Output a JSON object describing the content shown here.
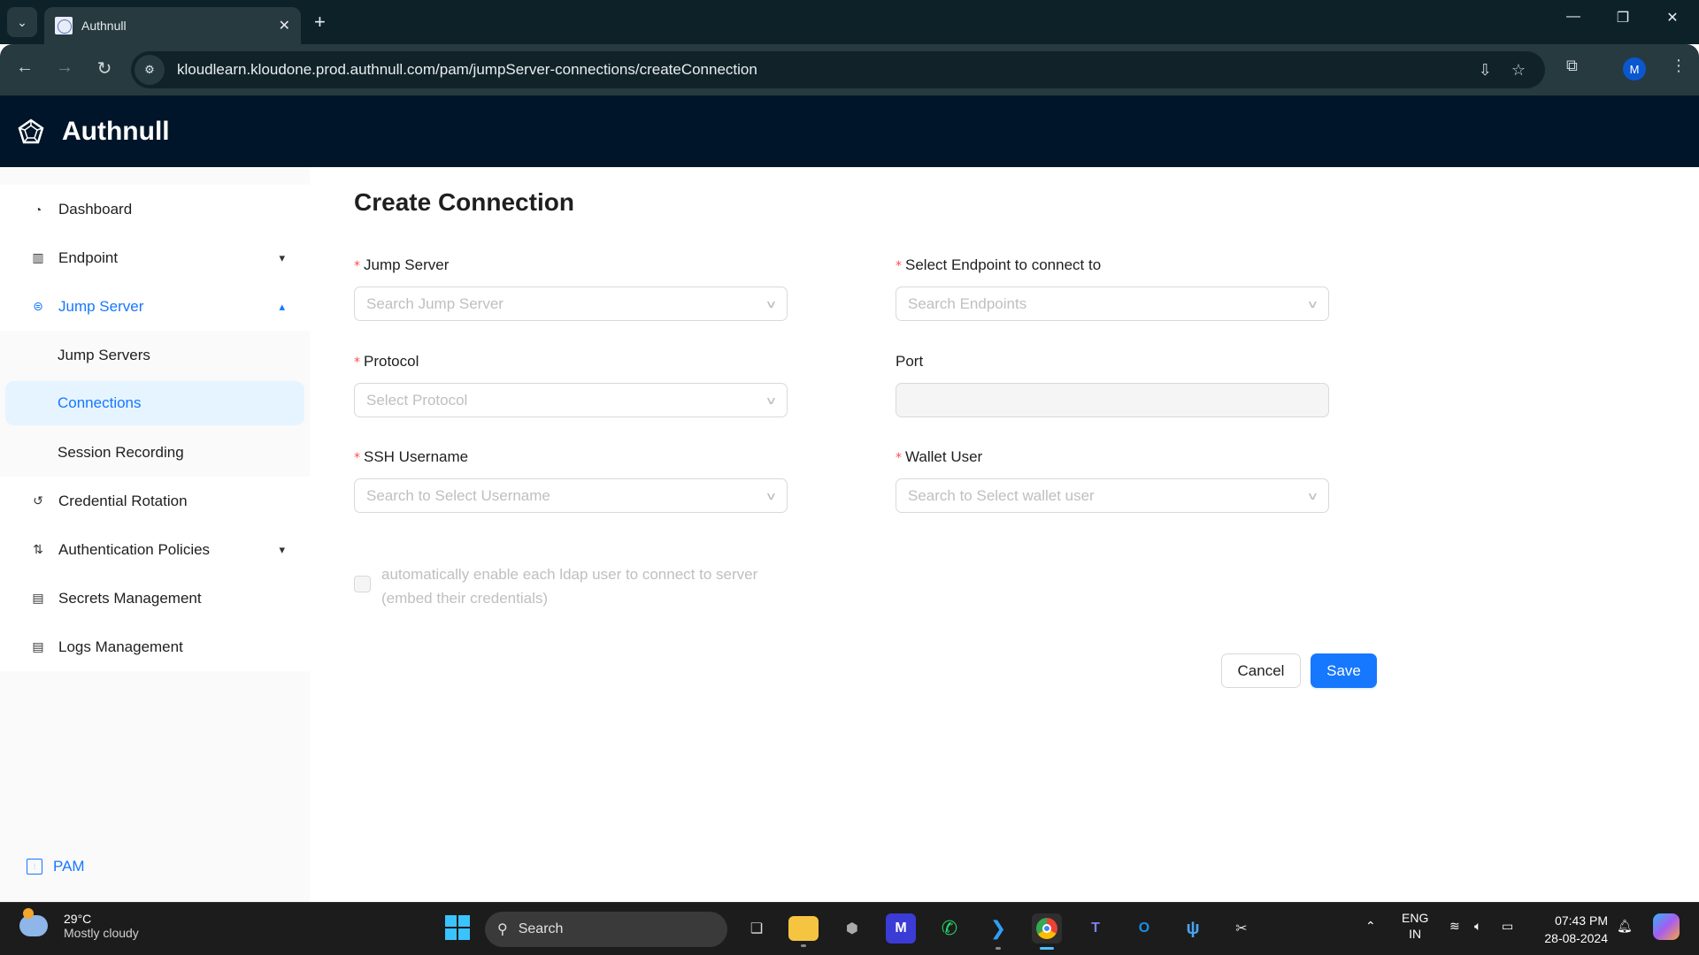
{
  "browser": {
    "tab_title": "Authnull",
    "url": "kloudlearn.kloudone.prod.authnull.com/pam/jumpServer-connections/createConnection",
    "profile_initial": "M"
  },
  "app": {
    "brand": "Authnull"
  },
  "sidebar": {
    "items": [
      {
        "label": "Dashboard",
        "icon": "dashboard-icon"
      },
      {
        "label": "Endpoint",
        "icon": "endpoint-icon",
        "expandable": true
      },
      {
        "label": "Jump Server",
        "icon": "jump-server-icon",
        "expandable": true,
        "expanded": true,
        "active": true
      },
      {
        "label": "Credential Rotation",
        "icon": "rotation-icon"
      },
      {
        "label": "Authentication Policies",
        "icon": "policy-icon",
        "expandable": true
      },
      {
        "label": "Secrets Management",
        "icon": "secrets-icon"
      },
      {
        "label": "Logs Management",
        "icon": "logs-icon"
      }
    ],
    "jump_server_sub": [
      {
        "label": "Jump Servers"
      },
      {
        "label": "Connections",
        "selected": true
      },
      {
        "label": "Session Recording"
      }
    ],
    "footer_label": "PAM"
  },
  "form": {
    "title": "Create Connection",
    "jump_server": {
      "label": "Jump Server",
      "required": true,
      "placeholder": "Search Jump Server"
    },
    "endpoint": {
      "label": "Select Endpoint to connect to",
      "required": true,
      "placeholder": "Search Endpoints"
    },
    "protocol": {
      "label": "Protocol",
      "required": true,
      "placeholder": "Select Protocol"
    },
    "port": {
      "label": "Port",
      "required": false,
      "value": ""
    },
    "ssh_username": {
      "label": "SSH Username",
      "required": true,
      "placeholder": "Search to Select Username"
    },
    "wallet_user": {
      "label": "Wallet User",
      "required": true,
      "placeholder": "Search to Select wallet user"
    },
    "auto_enable": {
      "label": "automatically enable each ldap user to connect to server (embed their credentials)",
      "checked": false,
      "disabled": true
    },
    "cancel_label": "Cancel",
    "save_label": "Save",
    "required_mark": "*"
  },
  "colors": {
    "primary": "#1677ff",
    "header_bg": "#001529",
    "required": "#ff4d4f"
  },
  "taskbar": {
    "weather_temp": "29°C",
    "weather_desc": "Mostly cloudy",
    "search_label": "Search",
    "lang_top": "ENG",
    "lang_bottom": "IN",
    "time": "07:43 PM",
    "date": "28-08-2024"
  }
}
